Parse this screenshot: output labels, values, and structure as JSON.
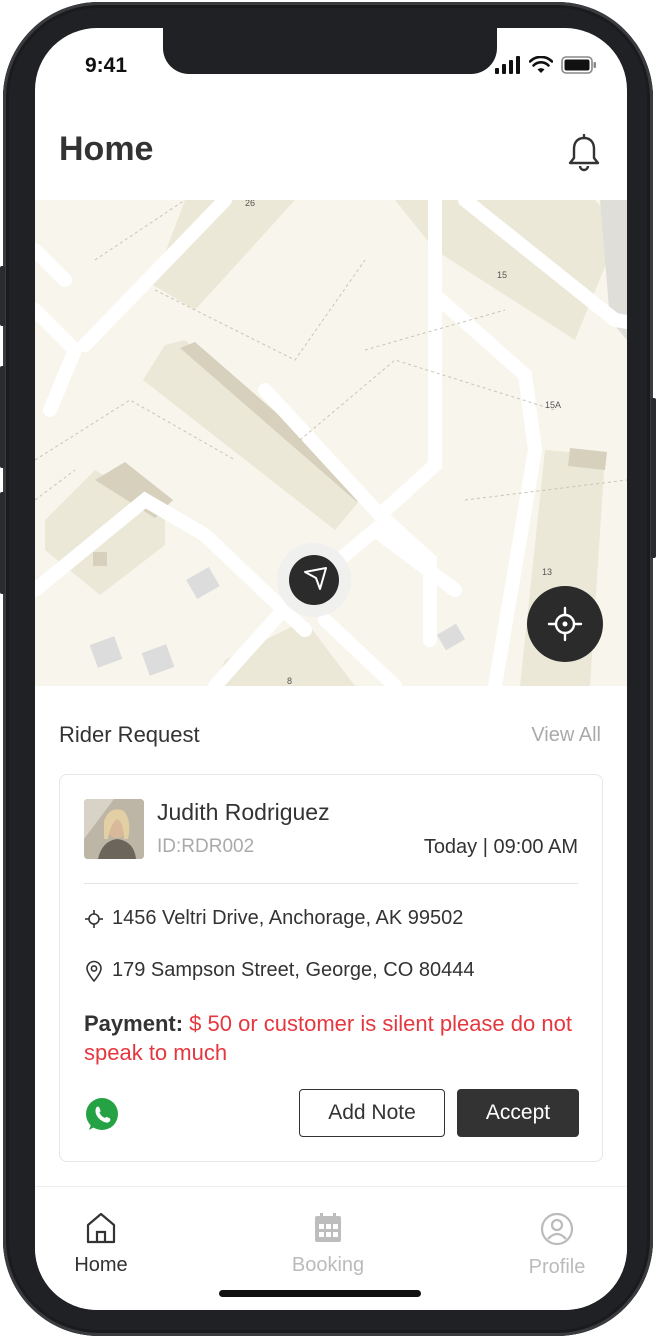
{
  "status_bar": {
    "time": "9:41"
  },
  "header": {
    "title": "Home"
  },
  "map": {
    "labels": [
      "26",
      "15",
      "15A",
      "13",
      "8"
    ]
  },
  "rider_request": {
    "section_title": "Rider Request",
    "view_all": "View All",
    "card": {
      "name": "Judith Rodriguez",
      "id": "ID:RDR002",
      "datetime": "Today | 09:00 AM",
      "pickup_address": "1456 Veltri Drive, Anchorage, AK 99502",
      "dropoff_address": "179 Sampson Street, George, CO 80444",
      "payment_label": "Payment:",
      "payment_value": "$ 50 or customer is silent please do not speak to much",
      "add_note_label": "Add Note",
      "accept_label": "Accept"
    }
  },
  "tabs": [
    {
      "label": "Home",
      "icon": "home-icon",
      "active": true
    },
    {
      "label": "Booking",
      "icon": "calendar-icon",
      "active": false
    },
    {
      "label": "Profile",
      "icon": "user-circle-icon",
      "active": false
    }
  ],
  "colors": {
    "accent_dark": "#333333",
    "payment_red": "#e5373f",
    "whatsapp_green": "#25a244",
    "map_bg": "#f8f5ec",
    "building": "#ece8d7"
  }
}
